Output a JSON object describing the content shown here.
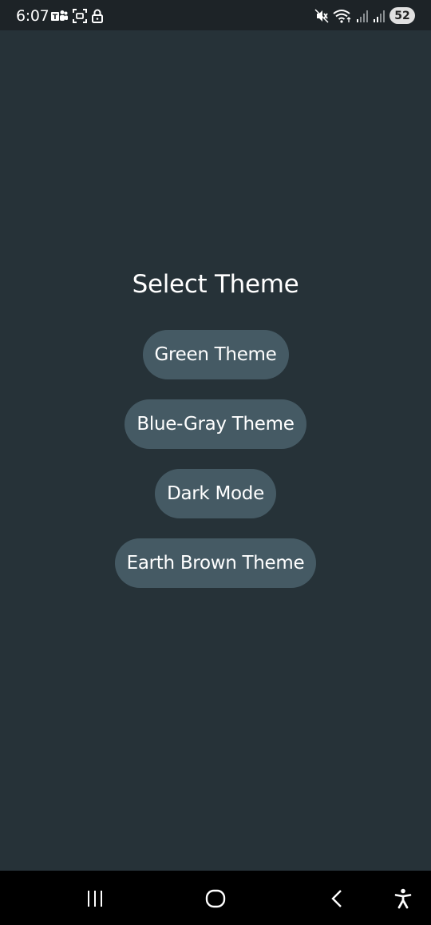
{
  "status_bar": {
    "time": "6:07",
    "battery": "52",
    "left_icons": [
      "teams-icon",
      "screenshot-icon",
      "lock-icon"
    ],
    "right_icons": [
      "mute-icon",
      "wifi-icon",
      "signal-icon",
      "signal-icon"
    ]
  },
  "screen": {
    "title": "Select Theme",
    "themes": [
      {
        "label": "Green Theme"
      },
      {
        "label": "Blue-Gray Theme"
      },
      {
        "label": "Dark Mode"
      },
      {
        "label": "Earth Brown Theme"
      }
    ]
  },
  "colors": {
    "background": "#263238",
    "button": "#455a64",
    "text": "#ffffff"
  },
  "nav_bar": {
    "items": [
      "recent-apps-icon",
      "home-icon",
      "back-icon",
      "accessibility-icon"
    ]
  }
}
